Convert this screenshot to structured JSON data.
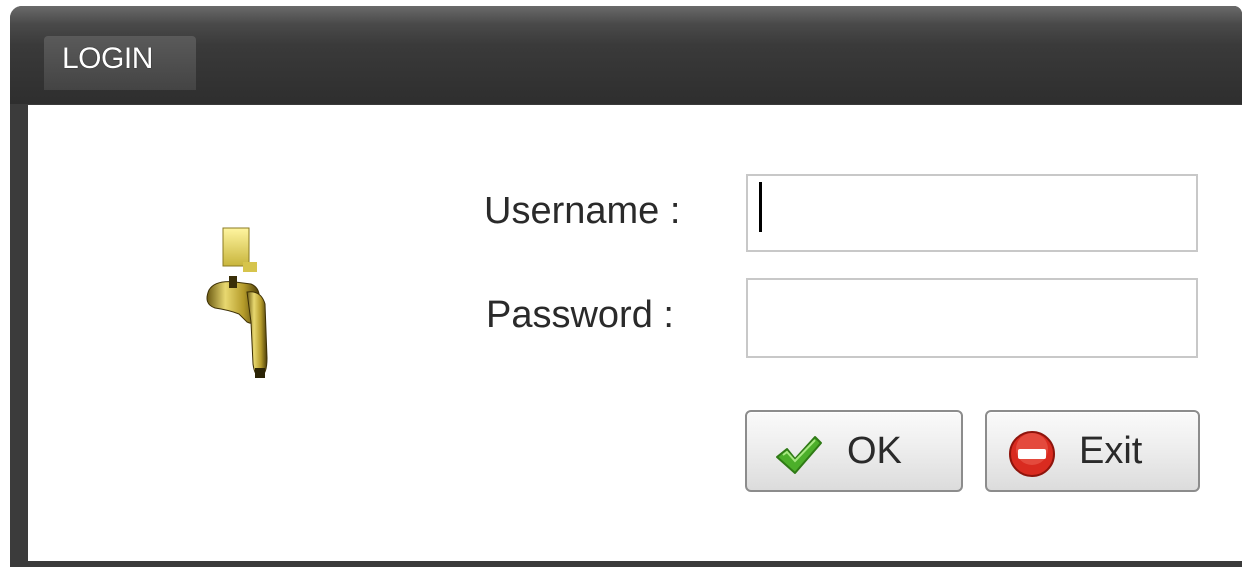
{
  "window": {
    "title": "LOGIN"
  },
  "form": {
    "username_label": "Username :",
    "username_value": "",
    "password_label": "Password :",
    "password_value": ""
  },
  "buttons": {
    "ok_label": "OK",
    "exit_label": "Exit"
  },
  "icons": {
    "login": "key-lock-icon",
    "ok": "checkmark-icon",
    "exit": "no-entry-icon"
  },
  "colors": {
    "title_bar": "#2e2e2e",
    "ok_check": "#4caf2a",
    "exit_red": "#d92b20",
    "key_gold": "#c9b43a"
  }
}
